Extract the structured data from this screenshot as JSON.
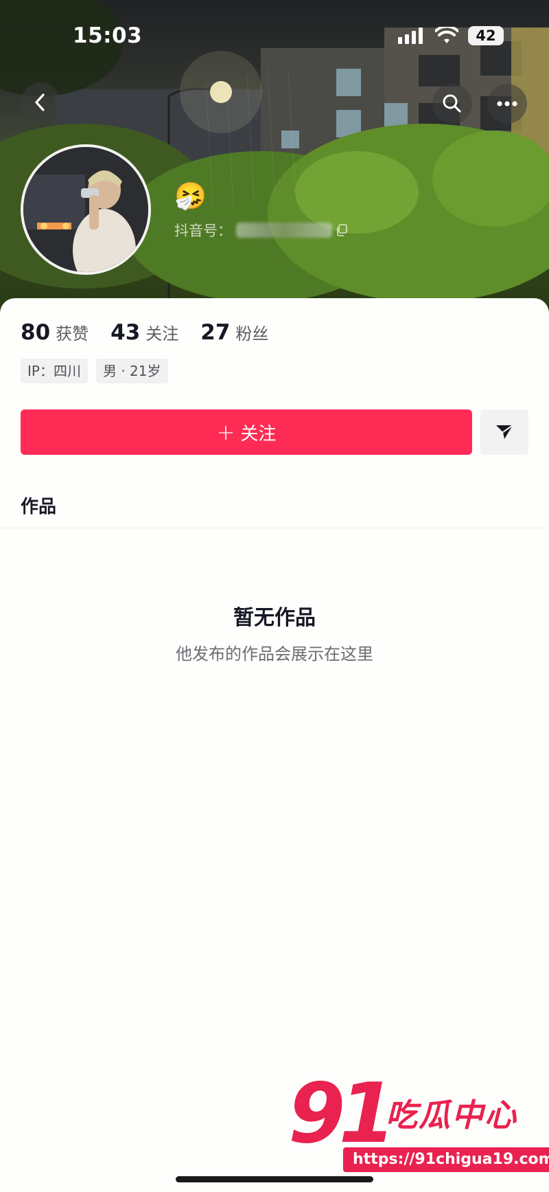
{
  "status_bar": {
    "time": "15:03",
    "battery": "42"
  },
  "profile": {
    "emoji": "🤧",
    "douyin_id_label": "抖音号："
  },
  "stats": [
    {
      "value": "80",
      "label": "获赞"
    },
    {
      "value": "43",
      "label": "关注"
    },
    {
      "value": "27",
      "label": "粉丝"
    }
  ],
  "tags": [
    "IP：四川",
    "男 · 21岁"
  ],
  "follow_button": {
    "plus": "+",
    "label": "关注"
  },
  "tabs": {
    "works": "作品"
  },
  "empty_state": {
    "title": "暂无作品",
    "subtitle": "他发布的作品会展示在这里"
  },
  "watermark": {
    "number": "91",
    "name": "吃瓜中心",
    "url": "https://91chigua19.com"
  },
  "colors": {
    "accent": "#fe2c55",
    "watermark": "#e9224f"
  }
}
